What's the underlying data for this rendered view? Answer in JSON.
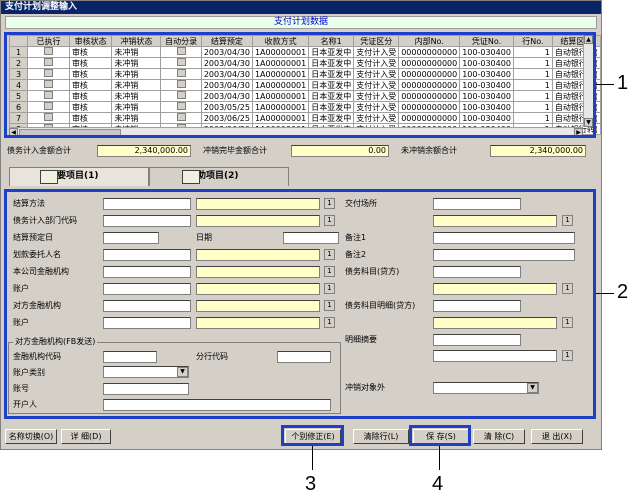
{
  "window": {
    "title": "支付计划调整输入",
    "caption": "支付计划数据"
  },
  "grid": {
    "headers": [
      "",
      "已执行",
      "审核状态",
      "冲销状态",
      "自动分录",
      "结算预定",
      "收款方式",
      "名称1",
      "凭证区分",
      "内部No.",
      "凭证No.",
      "行No.",
      "结算区分"
    ],
    "rows": [
      [
        "1",
        "",
        "审核",
        "未冲销",
        "",
        "2003/04/30",
        "1A00000001",
        "日本亚发中",
        "支付计入受",
        "00000000000",
        "100-030400",
        "1",
        "自动银行转("
      ],
      [
        "2",
        "",
        "审核",
        "未冲销",
        "",
        "2003/04/30",
        "1A00000001",
        "日本亚发中",
        "支付计入受",
        "00000000000",
        "100-030400",
        "1",
        "自动银行转("
      ],
      [
        "3",
        "",
        "审核",
        "未冲销",
        "",
        "2003/04/30",
        "1A00000001",
        "日本亚发中",
        "支付计入受",
        "00000000000",
        "100-030400",
        "1",
        "自动银行转("
      ],
      [
        "4",
        "",
        "审核",
        "未冲销",
        "",
        "2003/04/30",
        "1A00000001",
        "日本亚发中",
        "支付计入受",
        "00000000000",
        "100-030400",
        "1",
        "自动银行转("
      ],
      [
        "5",
        "",
        "审核",
        "未冲销",
        "",
        "2003/04/30",
        "1A00000001",
        "日本亚发中",
        "支付计入受",
        "00000000000",
        "100-030400",
        "1",
        "自动银行转("
      ],
      [
        "6",
        "",
        "审核",
        "未冲销",
        "",
        "2003/05/25",
        "1A00000001",
        "日本亚发中",
        "支付计入受",
        "00000000000",
        "100-030400",
        "1",
        "自动银行转("
      ],
      [
        "7",
        "",
        "审核",
        "未冲销",
        "",
        "2003/06/25",
        "1A00000001",
        "日本亚发中",
        "支付计入受",
        "00000000000",
        "100-030400",
        "1",
        "自动银行转("
      ],
      [
        "8",
        "",
        "审核",
        "未冲销",
        "",
        "2003/06/30",
        "1A00000001",
        "日本亚发中",
        "支付计入受",
        "00000000000",
        "100-030400",
        "1",
        "自动银行转("
      ]
    ]
  },
  "totals": {
    "debt_label": "债务计入金额合计",
    "debt_value": "2,340,000.00",
    "cleared_label": "冲销完毕金额合计",
    "cleared_value": "0.00",
    "remaining_label": "未冲销余额合计",
    "remaining_value": "2,340,000.00"
  },
  "tabs": {
    "main": "主要项目(1)",
    "aux": "辅助项目(2)"
  },
  "form": {
    "settle_method": "结算方法",
    "debt_dept": "债务计入部门代码",
    "settle_due": "结算预定日",
    "date": "日期",
    "payee": "划款委托人名",
    "company_bank": "本公司金融机构",
    "account1": "账户",
    "counter_bank": "对方金融机构",
    "account2": "账户",
    "delivery_place": "交付场所",
    "note1": "备注1",
    "note2": "备注2",
    "debt_item": "债务科目(贷方)",
    "debt_item_detail": "债务科目明细(贷方)",
    "detail_summary": "明细摘要",
    "offset_exclude": "冲销对象外"
  },
  "group": {
    "legend": "对方金融机构(FB发送)",
    "bank_code": "金融机构代码",
    "branch_code": "分行代码",
    "acct_type": "账户类别",
    "acct_no": "账号",
    "holder": "开户人"
  },
  "buttons": {
    "name_switch": "名称切换(O)",
    "detail": "详 细(D)",
    "individual_fix": "个别修正(E)",
    "clear_row": "清除行(L)",
    "save": "保 存(S)",
    "delete": "清 除(C)",
    "exit": "退 出(X)"
  },
  "callouts": [
    "1",
    "2",
    "3",
    "4"
  ],
  "colors": {
    "highlight": "#1e40c8",
    "title": "#0a246a",
    "input_yellow": "#ffffc8"
  }
}
